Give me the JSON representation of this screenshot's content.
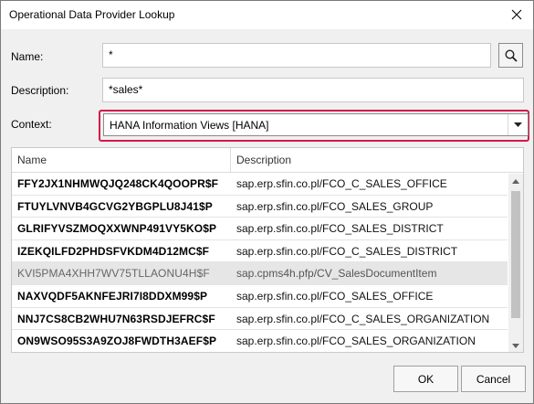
{
  "window": {
    "title": "Operational Data Provider Lookup"
  },
  "form": {
    "name_label": "Name:",
    "name_value": "*",
    "description_label": "Description:",
    "description_value": "*sales*",
    "context_label": "Context:",
    "context_value": "HANA Information Views [HANA]",
    "highlight_color": "#d4184a"
  },
  "table": {
    "columns": [
      "Name",
      "Description"
    ],
    "rows": [
      {
        "name": "FFY2JX1NHMWQJQ248CK4QOOPR$F",
        "description": "sap.erp.sfin.co.pl/FCO_C_SALES_OFFICE"
      },
      {
        "name": "FTUYLVNVB4GCVG2YBGPLU8J41$P",
        "description": "sap.erp.sfin.co.pl/FCO_SALES_GROUP"
      },
      {
        "name": "GLRIFYVSZMOQXXWNP491VY5KO$P",
        "description": "sap.erp.sfin.co.pl/FCO_SALES_DISTRICT"
      },
      {
        "name": "IZEKQILFD2PHDSFVKDM4D12MC$F",
        "description": "sap.erp.sfin.co.pl/FCO_C_SALES_DISTRICT"
      },
      {
        "name": "KVI5PMA4XHH7WV75TLLAONU4H$F",
        "description": "sap.cpms4h.pfp/CV_SalesDocumentItem"
      },
      {
        "name": "NAXVQDF5AKNFEJRI7I8DDXM99$P",
        "description": "sap.erp.sfin.co.pl/FCO_SALES_OFFICE"
      },
      {
        "name": "NNJ7CS8CB2WHU7N63RSDJEFRC$F",
        "description": "sap.erp.sfin.co.pl/FCO_C_SALES_ORGANIZATION"
      },
      {
        "name": "ON9WSO95S3A9ZOJ8FWDTH3AEF$P",
        "description": "sap.erp.sfin.co.pl/FCO_SALES_ORGANIZATION"
      }
    ],
    "selected_index": 4
  },
  "buttons": {
    "ok": "OK",
    "cancel": "Cancel"
  },
  "icons": {
    "close": "close-icon",
    "search": "search-icon",
    "dropdown": "chevron-down-icon"
  }
}
